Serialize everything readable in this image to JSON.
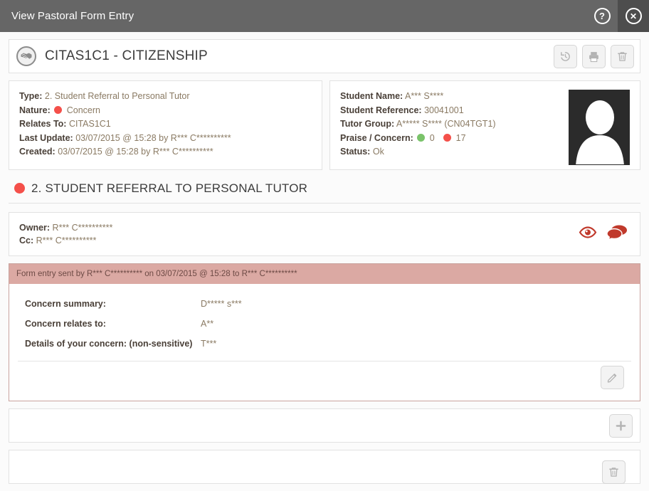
{
  "titlebar": {
    "title": "View Pastoral Form Entry",
    "help_icon": "question-mark",
    "close_icon": "x"
  },
  "document": {
    "title": "CITAS1C1 - CITIZENSHIP",
    "logo_icon": "handshake-icon",
    "actions": [
      {
        "name": "history",
        "icon": "history-icon"
      },
      {
        "name": "print",
        "icon": "printer-icon"
      },
      {
        "name": "delete",
        "icon": "trash-icon"
      }
    ]
  },
  "details": {
    "type_label": "Type:",
    "type_value": "2. Student Referral to Personal Tutor",
    "nature_label": "Nature:",
    "nature_value": "Concern",
    "nature_color": "#f4504a",
    "relates_label": "Relates To:",
    "relates_value": "CITAS1C1",
    "last_update_label": "Last Update:",
    "last_update_value": "03/07/2015 @ 15:28 by R*** C**********",
    "created_label": "Created:",
    "created_value": "03/07/2015 @ 15:28 by R*** C**********"
  },
  "student": {
    "name_label": "Student Name:",
    "name_value": "A*** S****",
    "reference_label": "Student Reference:",
    "reference_value": "30041001",
    "tutor_group_label": "Tutor Group:",
    "tutor_group_value": "A***** S**** (CN04TGT1)",
    "praise_concern_label": "Praise / Concern:",
    "praise_count": "0",
    "praise_color": "#7ac36a",
    "concern_count": "17",
    "concern_color": "#f4504a",
    "status_label": "Status:",
    "status_value": "Ok",
    "avatar_alt": "student-photo-placeholder"
  },
  "section": {
    "title": "2. STUDENT REFERRAL TO PERSONAL TUTOR",
    "marker_color": "#f4504a"
  },
  "owner": {
    "owner_label": "Owner:",
    "owner_value": "R*** C**********",
    "cc_label": "Cc:",
    "cc_value": "R*** C**********",
    "icons": [
      {
        "name": "eye-icon",
        "color": "#c0392b"
      },
      {
        "name": "comments-icon",
        "color": "#c0392b"
      }
    ]
  },
  "entry": {
    "banner": "Form entry sent by R*** C********** on 03/07/2015 @ 15:28 to R*** C**********",
    "banner_color": "#dba9a3",
    "fields": [
      {
        "label": "Concern summary:",
        "value": "D***** s***"
      },
      {
        "label": "Concern relates to:",
        "value": "A**"
      },
      {
        "label": "Details of your concern: (non-sensitive)",
        "value": "T***"
      }
    ],
    "edit_action": {
      "name": "edit",
      "icon": "pencil-icon"
    }
  },
  "add_panel": {
    "add_action": {
      "name": "add",
      "icon": "plus-icon"
    }
  },
  "footer": {
    "actions": [
      {
        "name": "history",
        "icon": "history-icon"
      },
      {
        "name": "print",
        "icon": "printer-icon"
      },
      {
        "name": "delete",
        "icon": "trash-icon"
      }
    ]
  }
}
